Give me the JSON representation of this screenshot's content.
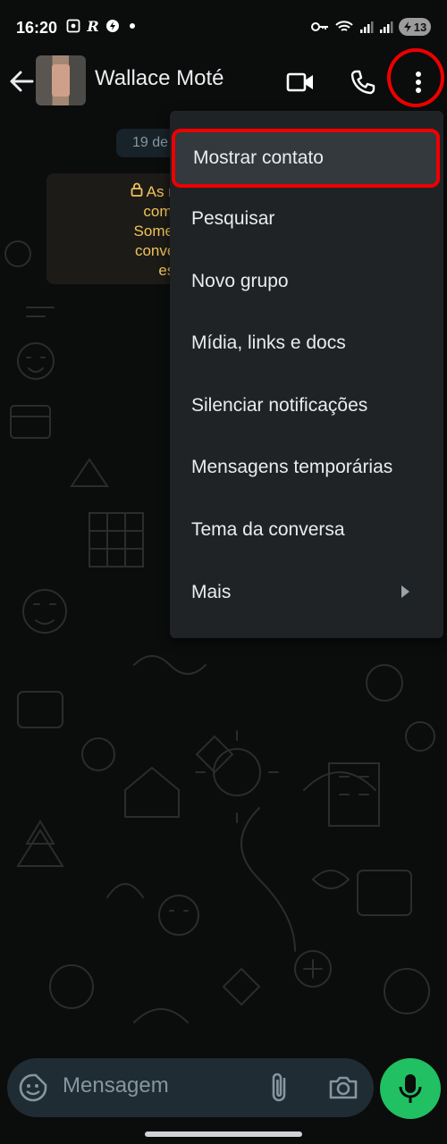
{
  "status_bar": {
    "time": "16:20",
    "battery": "13"
  },
  "header": {
    "contact_name": "Wallace Moté"
  },
  "chat": {
    "date_pill": "19 de",
    "encryption_notice_lines": [
      "As mensage",
      "com a cript",
      "Somente as p",
      "conversa pod",
      "esse c"
    ]
  },
  "menu": {
    "items": [
      {
        "label": "Mostrar contato"
      },
      {
        "label": "Pesquisar"
      },
      {
        "label": "Novo grupo"
      },
      {
        "label": "Mídia, links e docs"
      },
      {
        "label": "Silenciar notificações"
      },
      {
        "label": "Mensagens temporárias"
      },
      {
        "label": "Tema da conversa"
      },
      {
        "label": "Mais"
      }
    ]
  },
  "input": {
    "placeholder": "Mensagem"
  },
  "colors": {
    "accent_green": "#21c063",
    "highlight_red": "#ee0000",
    "encryption_text": "#f0c35a"
  }
}
